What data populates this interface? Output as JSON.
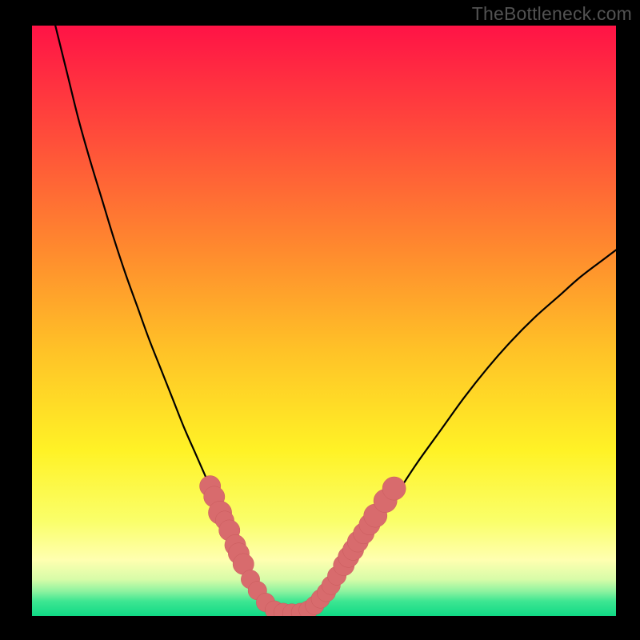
{
  "watermark": "TheBottleneck.com",
  "colors": {
    "frame": "#000000",
    "watermark_text": "#525252",
    "curve": "#000000",
    "marker_fill": "#d86b6d",
    "marker_stroke": "#c95a5c",
    "gradient_stops": [
      {
        "offset": 0.0,
        "color": "#ff1346"
      },
      {
        "offset": 0.18,
        "color": "#ff4a3b"
      },
      {
        "offset": 0.38,
        "color": "#ff8a2e"
      },
      {
        "offset": 0.55,
        "color": "#ffc227"
      },
      {
        "offset": 0.72,
        "color": "#fff226"
      },
      {
        "offset": 0.84,
        "color": "#faff6a"
      },
      {
        "offset": 0.905,
        "color": "#ffffb0"
      },
      {
        "offset": 0.938,
        "color": "#d7fca8"
      },
      {
        "offset": 0.958,
        "color": "#8ef3a0"
      },
      {
        "offset": 0.975,
        "color": "#3de692"
      },
      {
        "offset": 1.0,
        "color": "#10d985"
      }
    ]
  },
  "chart_data": {
    "type": "line",
    "title": "",
    "xlabel": "",
    "ylabel": "",
    "xlim": [
      0,
      100
    ],
    "ylim": [
      0,
      100
    ],
    "series": [
      {
        "name": "bottleneck-curve",
        "x": [
          4,
          6,
          8,
          10,
          12,
          14,
          16,
          18,
          20,
          22,
          24,
          26,
          28,
          30,
          32,
          33.5,
          35,
          36.5,
          38,
          39.5,
          41,
          42.5,
          44,
          46,
          48,
          50,
          52,
          54,
          57,
          60,
          63,
          66,
          70,
          74,
          78,
          82,
          86,
          90,
          94,
          98,
          100
        ],
        "y": [
          100,
          92,
          84,
          77,
          70.5,
          64,
          58,
          52.5,
          47,
          42,
          37,
          32,
          27.5,
          23,
          18.5,
          15.5,
          12.5,
          9.5,
          6.5,
          4,
          2,
          0.8,
          0.5,
          0.5,
          1.2,
          3,
          5.5,
          8.5,
          12.5,
          17,
          21.5,
          26,
          31.5,
          37,
          42,
          46.5,
          50.5,
          54,
          57.5,
          60.5,
          62
        ]
      }
    ],
    "markers": {
      "name": "highlight-points",
      "points": [
        {
          "x": 30.5,
          "y": 22,
          "r": 1.8
        },
        {
          "x": 31.2,
          "y": 20.2,
          "r": 1.8
        },
        {
          "x": 32.2,
          "y": 17.5,
          "r": 2.0
        },
        {
          "x": 33.0,
          "y": 16.2,
          "r": 1.6
        },
        {
          "x": 33.8,
          "y": 14.5,
          "r": 1.8
        },
        {
          "x": 34.8,
          "y": 12.0,
          "r": 1.8
        },
        {
          "x": 35.4,
          "y": 10.6,
          "r": 1.8
        },
        {
          "x": 36.2,
          "y": 8.8,
          "r": 1.8
        },
        {
          "x": 37.4,
          "y": 6.2,
          "r": 1.6
        },
        {
          "x": 38.6,
          "y": 4.3,
          "r": 1.6
        },
        {
          "x": 40.0,
          "y": 2.3,
          "r": 1.6
        },
        {
          "x": 41.5,
          "y": 1.0,
          "r": 1.6
        },
        {
          "x": 43.0,
          "y": 0.6,
          "r": 1.6
        },
        {
          "x": 44.5,
          "y": 0.5,
          "r": 1.6
        },
        {
          "x": 46.0,
          "y": 0.6,
          "r": 1.6
        },
        {
          "x": 47.3,
          "y": 1.0,
          "r": 1.6
        },
        {
          "x": 48.4,
          "y": 1.8,
          "r": 1.6
        },
        {
          "x": 49.4,
          "y": 2.9,
          "r": 1.6
        },
        {
          "x": 50.4,
          "y": 4.0,
          "r": 1.6
        },
        {
          "x": 51.2,
          "y": 5.2,
          "r": 1.6
        },
        {
          "x": 52.2,
          "y": 6.8,
          "r": 1.6
        },
        {
          "x": 53.4,
          "y": 8.6,
          "r": 1.8
        },
        {
          "x": 54.2,
          "y": 10.0,
          "r": 1.8
        },
        {
          "x": 55.0,
          "y": 11.2,
          "r": 1.8
        },
        {
          "x": 55.8,
          "y": 12.6,
          "r": 1.8
        },
        {
          "x": 56.8,
          "y": 14.0,
          "r": 1.8
        },
        {
          "x": 57.8,
          "y": 15.5,
          "r": 1.8
        },
        {
          "x": 58.8,
          "y": 17.0,
          "r": 2.0
        },
        {
          "x": 60.5,
          "y": 19.5,
          "r": 2.0
        },
        {
          "x": 62.0,
          "y": 21.6,
          "r": 2.0
        }
      ]
    }
  }
}
